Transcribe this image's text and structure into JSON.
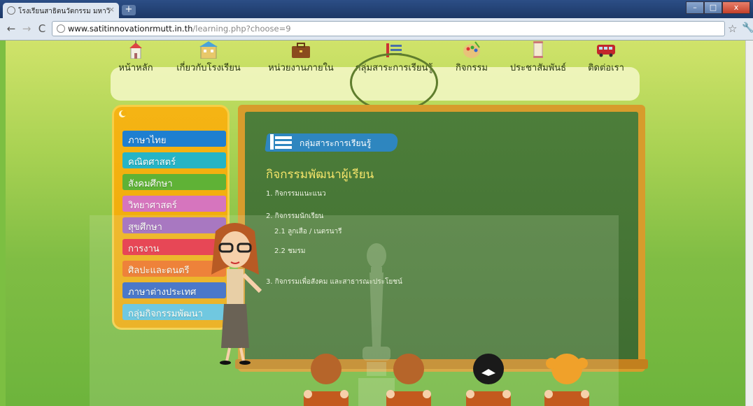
{
  "browser": {
    "tab_title": "โรงเรียนสาธิตนวัตกรรม มหาวิ",
    "tab_close": "×",
    "newtab": "+",
    "url_host": "www.satitinnovationrmutt.in.th",
    "url_path": "/learning.php?choose=9",
    "window_buttons": [
      "–",
      "□",
      "x"
    ]
  },
  "nav": {
    "items": [
      {
        "label": "หน้าหลัก",
        "icon": "school-icon"
      },
      {
        "label": "เกี่ยวกับโรงเรียน",
        "icon": "building-icon"
      },
      {
        "label": "หน่วยงานภายใน",
        "icon": "briefcase-icon"
      },
      {
        "label": "กลุ่มสาระการเรียนรู้",
        "icon": "books-icon"
      },
      {
        "label": "กิจกรรม",
        "icon": "palette-icon"
      },
      {
        "label": "ประชาสัมพันธ์",
        "icon": "scroll-icon"
      },
      {
        "label": "ติดต่อเรา",
        "icon": "bus-icon"
      }
    ]
  },
  "subjects": {
    "items": [
      {
        "label": "ภาษาไทย",
        "color": "#1e7fd0"
      },
      {
        "label": "คณิตศาสตร์",
        "color": "#25b4c6"
      },
      {
        "label": "สังคมศึกษา",
        "color": "#5fb236"
      },
      {
        "label": "วิทยาศาสตร์",
        "color": "#d675be"
      },
      {
        "label": "สุขศึกษา",
        "color": "#9d5fc0"
      },
      {
        "label": "การงาน",
        "color": "#e9233e"
      },
      {
        "label": "ศิลปะและดนตรี",
        "color": "#f26b1c"
      },
      {
        "label": "ภาษาต่างประเทศ",
        "color": "#2a5fcb"
      },
      {
        "label": "กลุ่มกิจกรรมพัฒนา",
        "color": "#58c0e6"
      }
    ]
  },
  "board": {
    "badge": "กลุ่มสาระการเรียนรู้",
    "title": "กิจกรรมพัฒนาผู้เรียน",
    "lines": [
      "1. กิจกรรมแนะแนว",
      "2. กิจกรรมนักเรียน",
      "2.1 ลูกเสือ / เนตรนารี",
      "2.2 ชมรม",
      "3. กิจกรรมเพื่อสังคม และสาธารณะประโยชน์"
    ]
  },
  "colors": {
    "accent": "#f5b414",
    "board": "#4a7a38",
    "frame": "#d79c2c",
    "title_yellow": "#f4e46a"
  }
}
